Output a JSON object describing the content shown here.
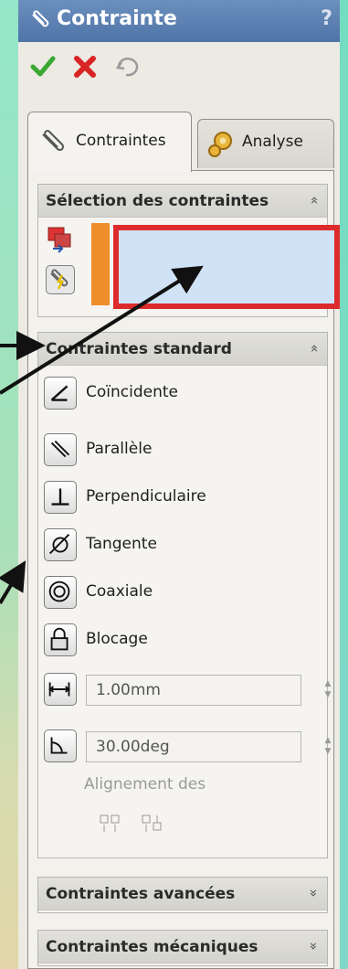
{
  "title": "Contrainte",
  "help": "?",
  "tabs": [
    {
      "label": "Contraintes"
    },
    {
      "label": "Analyse"
    }
  ],
  "groups": {
    "selection": {
      "title": "Sélection des contraintes",
      "chevron": "»"
    },
    "standard": {
      "title": "Contraintes standard",
      "chevron": "»"
    },
    "advanced": {
      "title": "Contraintes avancées",
      "chevron": "»"
    },
    "mechanical": {
      "title": "Contraintes mécaniques",
      "chevron": "»"
    }
  },
  "constraints": [
    {
      "label": "Coïncidente",
      "icon": "coincident-icon"
    },
    {
      "label": "Parallèle",
      "icon": "parallel-icon"
    },
    {
      "label": "Perpendiculaire",
      "icon": "perpendicular-icon"
    },
    {
      "label": "Tangente",
      "icon": "tangent-icon"
    },
    {
      "label": "Coaxiale",
      "icon": "coaxial-icon"
    },
    {
      "label": "Blocage",
      "icon": "lock-icon"
    }
  ],
  "distance": {
    "value": "1.00mm"
  },
  "angle": {
    "value": "30.00deg"
  },
  "alignment_label": "Alignement des",
  "colors": {
    "title_bar": "#5a7fb3",
    "accent_red": "#dd2b2b",
    "accent_orange": "#ee8e2a",
    "selection_fill": "#cfe2f6"
  }
}
